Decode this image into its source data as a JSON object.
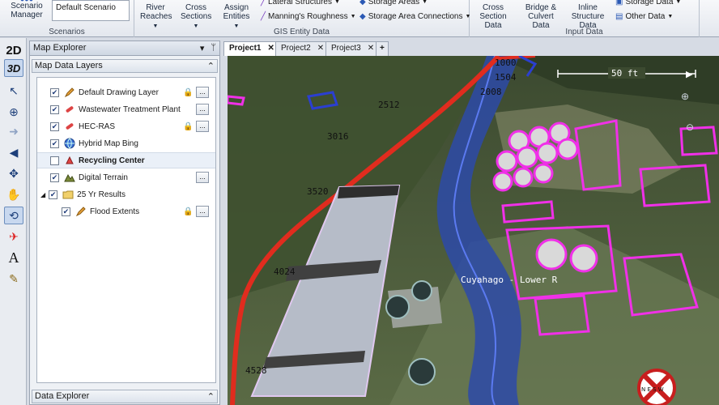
{
  "ribbon": {
    "scenarios": {
      "manager_label": "Scenario Manager",
      "current": "Default Scenario",
      "caption": "Scenarios"
    },
    "gis": {
      "caption": "GIS Entity Data",
      "river_reaches": "River Reaches",
      "cross_sections": "Cross Sections",
      "assign_entities": "Assign Entities",
      "lateral_structures": "Lateral Structures",
      "mannings": "Manning's Roughness",
      "storage_areas": "Storage Areas",
      "storage_connections": "Storage Area Connections"
    },
    "input": {
      "caption": "Input Data",
      "cross_section_data": "Cross Section Data",
      "bridge_culvert": "Bridge & Culvert Data",
      "inline_structure": "Inline Structure Data",
      "storage_data": "Storage Data",
      "other_data": "Other Data"
    }
  },
  "tools": [
    "2D",
    "3D"
  ],
  "explorer": {
    "title": "Map Explorer",
    "layers_header": "Map Data Layers",
    "data_explorer": "Data Explorer",
    "layers": [
      {
        "label": "Default Drawing Layer",
        "checked": true,
        "lock": true,
        "dots": true
      },
      {
        "label": "Wastewater Treatment Plant",
        "checked": true,
        "lock": false,
        "dots": true
      },
      {
        "label": "HEC-RAS",
        "checked": true,
        "lock": true,
        "dots": true
      },
      {
        "label": "Hybrid Map Bing",
        "checked": true,
        "lock": false,
        "dots": false
      },
      {
        "label": "Recycling Center",
        "checked": false,
        "lock": false,
        "dots": false,
        "bold": true
      },
      {
        "label": "Digital Terrain",
        "checked": true,
        "lock": false,
        "dots": true
      },
      {
        "label": "25 Yr Results",
        "checked": true,
        "lock": false,
        "dots": false
      },
      {
        "label": "Flood Extents",
        "checked": true,
        "lock": true,
        "dots": true
      }
    ]
  },
  "tabs": [
    "Project1",
    "Project2",
    "Project3"
  ],
  "map": {
    "scale_label": "50 ft",
    "stations": [
      "1000",
      "1504",
      "2008",
      "2512",
      "3016",
      "3520",
      "4024",
      "4528"
    ],
    "reach_label": "Cuyahago - Lower R",
    "compass": "N E S W",
    "colors": {
      "river": "#2b3fd0",
      "highlight": "#f030e8",
      "centerline": "#e02c1e"
    }
  }
}
